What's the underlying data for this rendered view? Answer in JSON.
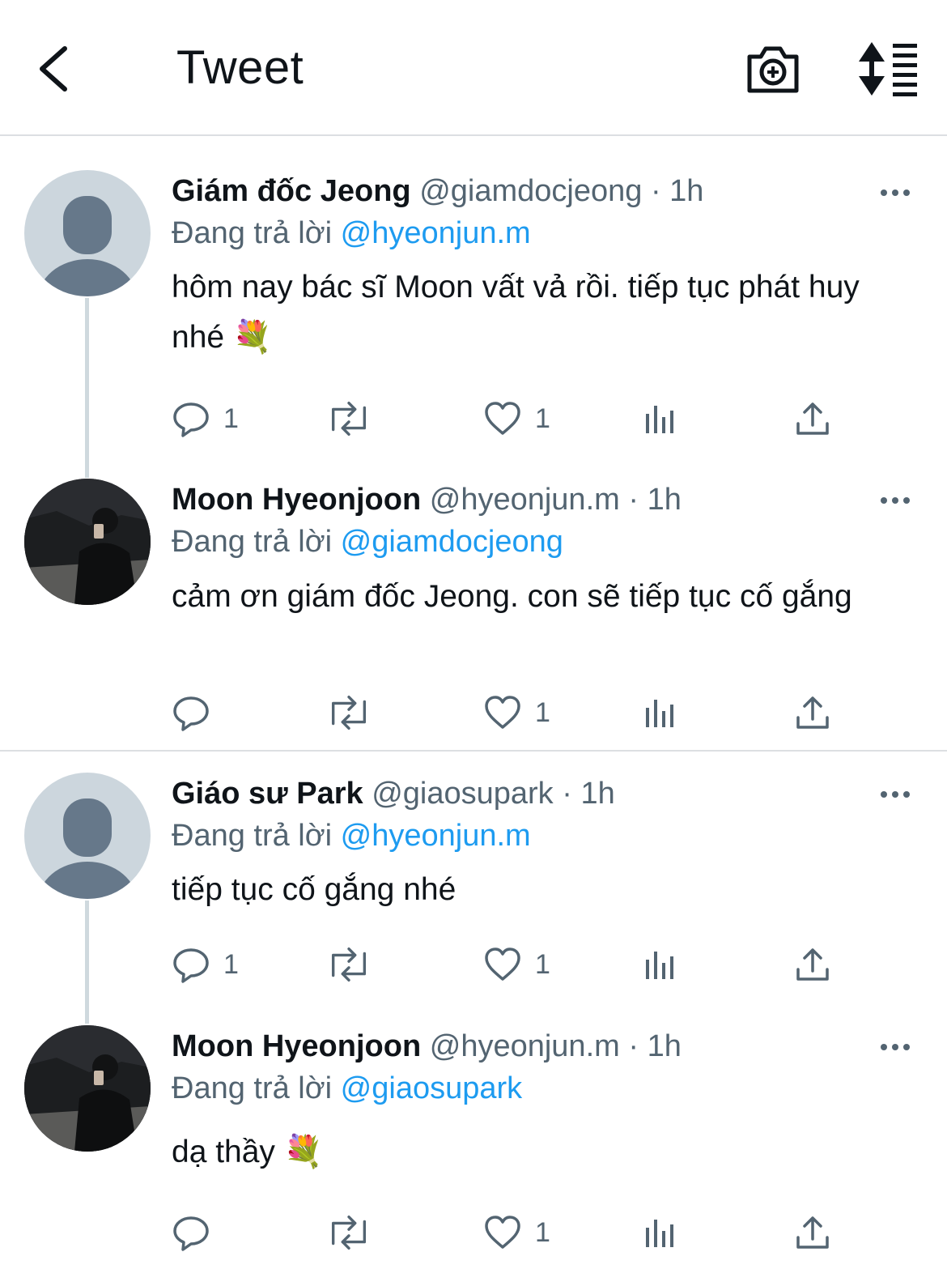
{
  "header": {
    "title": "Tweet",
    "back_icon": "chevron-left-icon",
    "camera_icon": "camera-add-icon",
    "sort_icon": "sort-list-icon"
  },
  "tweets": [
    {
      "name": "Giám đốc Jeong",
      "handle": "@giamdocjeong",
      "time": "· 1h",
      "replying_label": "Đang trả lời",
      "replying_to": "@hyeonjun.m",
      "text": "hôm nay bác sĩ Moon vất vả rồi. tiếp tục phát huy nhé 💐",
      "reply_count": "1",
      "like_count": "1"
    },
    {
      "name": "Moon Hyeonjoon",
      "handle": "@hyeonjun.m",
      "time": "· 1h",
      "replying_label": "Đang trả lời",
      "replying_to": "@giamdocjeong",
      "text": "cảm ơn giám đốc Jeong. con sẽ tiếp tục cố gắng",
      "reply_count": "",
      "like_count": "1"
    },
    {
      "name": "Giáo sư Park",
      "handle": "@giaosupark",
      "time": "· 1h",
      "replying_label": "Đang trả lời",
      "replying_to": "@hyeonjun.m",
      "text": "tiếp tục cố gắng nhé",
      "reply_count": "1",
      "like_count": "1"
    },
    {
      "name": "Moon Hyeonjoon",
      "handle": "@hyeonjun.m",
      "time": "· 1h",
      "replying_label": "Đang trả lời",
      "replying_to": "@giaosupark",
      "text": "dạ thầy 💐",
      "reply_count": "",
      "like_count": "1"
    }
  ],
  "colors": {
    "accent": "#1d9bf0",
    "secondary_text": "#536471",
    "primary_text": "#0f1419",
    "divider": "#dcdfe2",
    "thread_line": "#cfd9de"
  }
}
